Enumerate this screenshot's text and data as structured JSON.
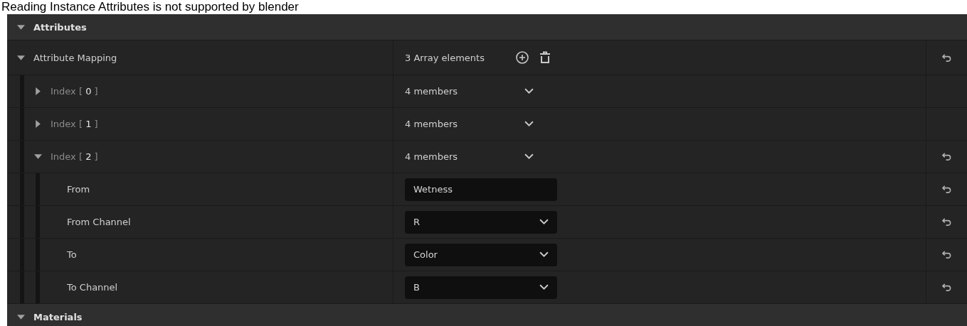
{
  "banner": "Reading Instance Attributes is not supported by blender",
  "sections": [
    {
      "title": "Attributes",
      "expanded": true,
      "rows": [
        {
          "kind": "array",
          "name": "Attribute Mapping",
          "expanded": true,
          "value": "3 Array elements",
          "reset": true,
          "children": [
            {
              "kind": "struct",
              "name": "Index [ **0** ]",
              "expanded": false,
              "value": "4 members",
              "reset": false
            },
            {
              "kind": "struct",
              "name": "Index [ **1** ]",
              "expanded": false,
              "value": "4 members",
              "reset": false
            },
            {
              "kind": "struct",
              "name": "Index [ **2** ]",
              "expanded": true,
              "value": "4 members",
              "reset": true,
              "children": [
                {
                  "kind": "text",
                  "name": "From",
                  "value": "Wetness",
                  "reset": true
                },
                {
                  "kind": "combo",
                  "name": "From Channel",
                  "value": "R",
                  "reset": true
                },
                {
                  "kind": "combo",
                  "name": "To",
                  "value": "Color",
                  "reset": true
                },
                {
                  "kind": "combo",
                  "name": "To Channel",
                  "value": "B",
                  "reset": true
                }
              ]
            }
          ]
        }
      ]
    },
    {
      "title": "Materials",
      "expanded": true
    }
  ]
}
